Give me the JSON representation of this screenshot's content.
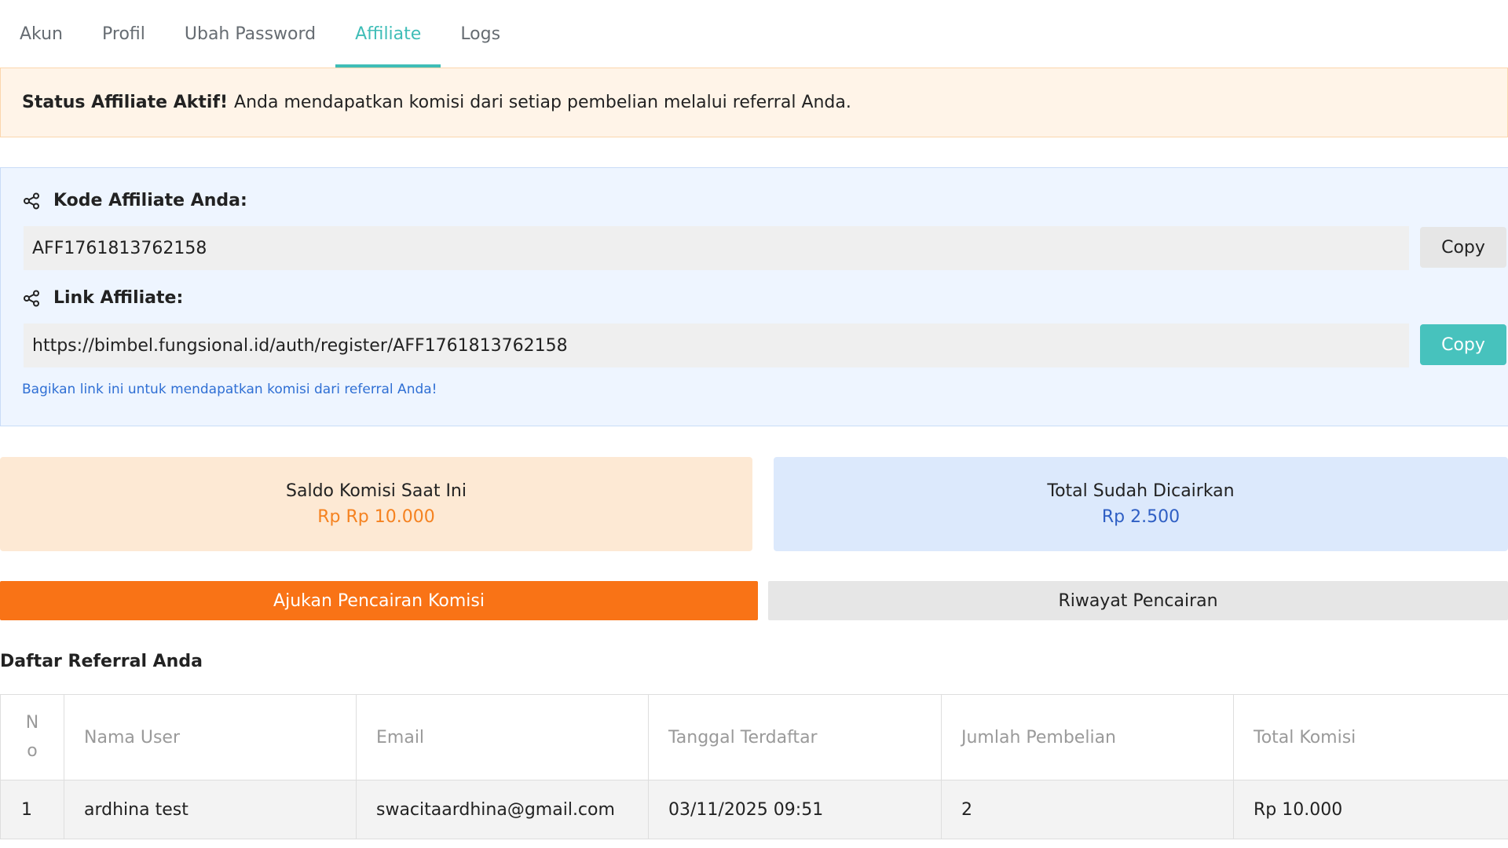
{
  "tabs": [
    {
      "label": "Akun",
      "active": false
    },
    {
      "label": "Profil",
      "active": false
    },
    {
      "label": "Ubah Password",
      "active": false
    },
    {
      "label": "Affiliate",
      "active": true
    },
    {
      "label": "Logs",
      "active": false
    }
  ],
  "alert": {
    "strong": "Status Affiliate Aktif!",
    "text": "Anda mendapatkan komisi dari setiap pembelian melalui referral Anda."
  },
  "affiliate": {
    "code_label": "Kode Affiliate Anda:",
    "code_value": "AFF1761813762158",
    "code_copy": "Copy",
    "link_label": "Link Affiliate:",
    "link_value": "https://bimbel.fungsional.id/auth/register/AFF1761813762158",
    "link_copy": "Copy",
    "hint": "Bagikan link ini untuk mendapatkan komisi dari referral Anda!",
    "icon": "share-icon"
  },
  "stats": {
    "balance_title": "Saldo Komisi Saat Ini",
    "balance_value": "Rp Rp 10.000",
    "withdrawn_title": "Total Sudah Dicairkan",
    "withdrawn_value": "Rp 2.500"
  },
  "actions": {
    "request_label": "Ajukan Pencairan Komisi",
    "history_label": "Riwayat Pencairan"
  },
  "referrals": {
    "title": "Daftar Referral Anda",
    "headers": {
      "no_line1": "N",
      "no_line2": "o",
      "name": "Nama User",
      "email": "Email",
      "date": "Tanggal Terdaftar",
      "purchases": "Jumlah Pembelian",
      "commission": "Total Komisi"
    },
    "rows": [
      {
        "no": "1",
        "name": "ardhina test",
        "email": "swacitaardhina@gmail.com",
        "date": "03/11/2025 09:51",
        "purchases": "2",
        "commission": "Rp 10.000"
      }
    ]
  },
  "colors": {
    "accent_teal": "#3fbdb7",
    "orange": "#f97316",
    "blue_text": "#2f5fc4"
  }
}
